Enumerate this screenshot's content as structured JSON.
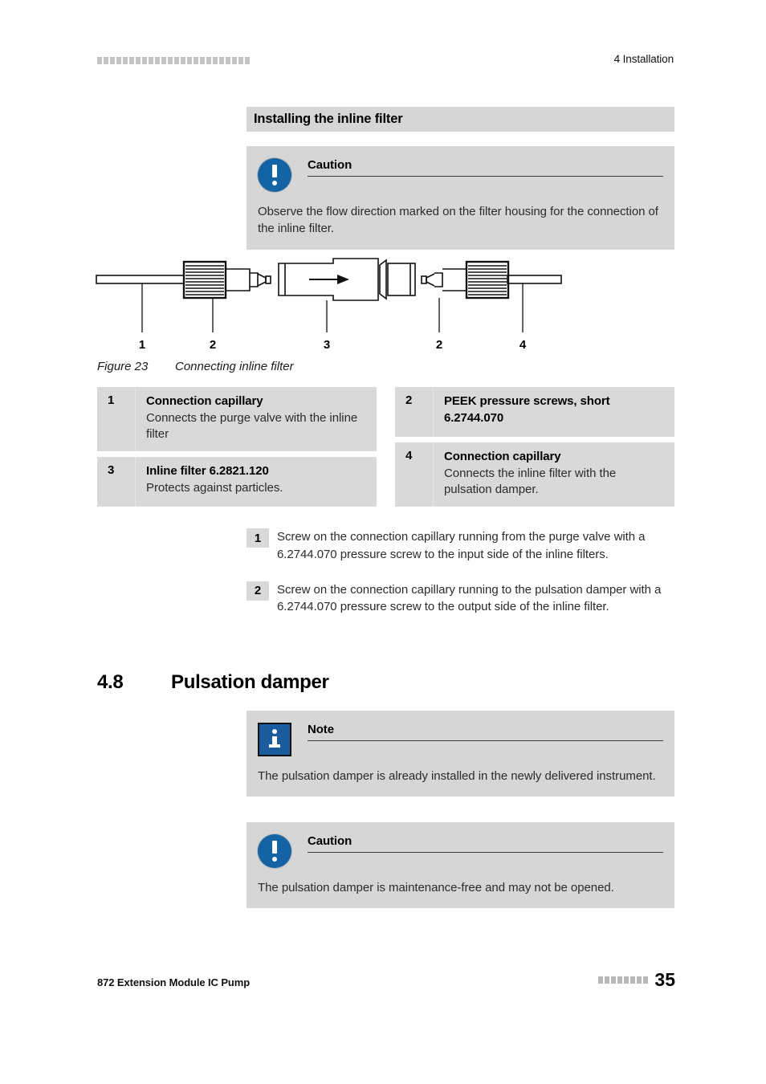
{
  "header": {
    "chapter": "4 Installation",
    "deco_count": 24
  },
  "section_title": "Installing the inline filter",
  "caution_1": {
    "label": "Caution",
    "icon": "caution-icon",
    "body": "Observe the flow direction marked on the filter housing for the connection of the inline filter."
  },
  "figure": {
    "caption_number": "Figure 23",
    "caption_text": "Connecting inline filter",
    "callouts": [
      "1",
      "2",
      "3",
      "2",
      "4"
    ],
    "flow_arrow": "right"
  },
  "legend": {
    "left": [
      {
        "num": "1",
        "title": "Connection capillary",
        "desc": "Connects the purge valve with the inline filter"
      },
      {
        "num": "3",
        "title": "Inline filter 6.2821.120",
        "desc": "Protects against particles."
      }
    ],
    "right": [
      {
        "num": "2",
        "title": "PEEK pressure screws, short 6.2744.070",
        "desc": ""
      },
      {
        "num": "4",
        "title": "Connection capillary",
        "desc": "Connects the inline filter with the pulsation damper."
      }
    ]
  },
  "steps": [
    {
      "num": "1",
      "text": "Screw on the connection capillary running from the purge valve with a 6.2744.070 pressure screw to the input side of the inline filters."
    },
    {
      "num": "2",
      "text": "Screw on the connection capillary running to the pulsation damper with a 6.2744.070 pressure screw to the output side of the inline filter."
    }
  ],
  "heading": {
    "number": "4.8",
    "title": "Pulsation damper"
  },
  "note": {
    "label": "Note",
    "icon": "info-icon",
    "body": "The pulsation damper is already installed in the newly delivered instrument."
  },
  "caution_2": {
    "label": "Caution",
    "icon": "caution-icon",
    "body": "The pulsation damper is maintenance-free and may not be opened."
  },
  "footer": {
    "doc_title": "872 Extension Module IC Pump",
    "page_number": "35",
    "deco_count": 8
  },
  "colors": {
    "box_gray": "#d6d6d6",
    "legend_gray": "#d9d9d9",
    "icon_blue": "#1464a5",
    "note_blue": "#1b5c9e"
  }
}
